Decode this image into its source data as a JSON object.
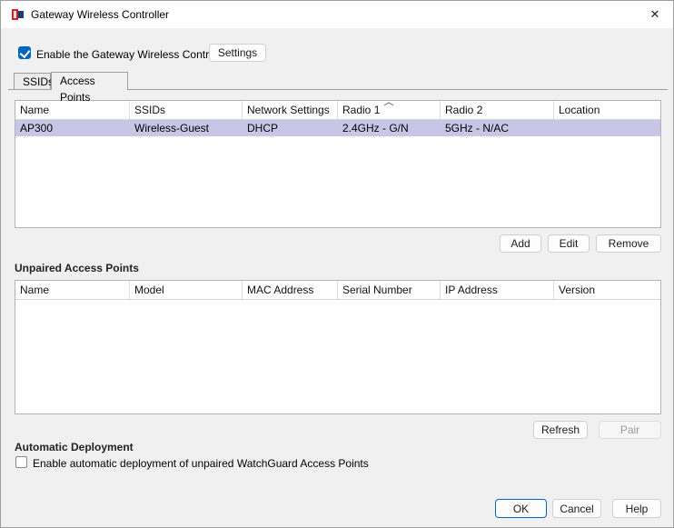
{
  "window": {
    "title": "Gateway Wireless Controller",
    "close_glyph": "✕"
  },
  "enable_controller": {
    "label": "Enable the Gateway Wireless Controller",
    "checked": true,
    "settings_button": "Settings"
  },
  "tabs": [
    {
      "label": "SSIDs",
      "selected": false
    },
    {
      "label": "Access Points",
      "selected": true
    }
  ],
  "access_points_table": {
    "columns": [
      "Name",
      "SSIDs",
      "Network Settings",
      "Radio 1",
      "Radio 2",
      "Location"
    ],
    "sorted_column": "Radio 1",
    "sort_direction": "asc",
    "rows": [
      {
        "selected": true,
        "cells": [
          "AP300",
          "Wireless-Guest",
          "DHCP",
          "2.4GHz - G/N",
          "5GHz - N/AC",
          ""
        ]
      }
    ]
  },
  "access_points_buttons": {
    "add": "Add",
    "edit": "Edit",
    "remove": "Remove"
  },
  "unpaired": {
    "heading": "Unpaired Access Points",
    "columns": [
      "Name",
      "Model",
      "MAC Address",
      "Serial Number",
      "IP Address",
      "Version"
    ],
    "rows": []
  },
  "unpaired_buttons": {
    "refresh": "Refresh",
    "pair": "Pair",
    "pair_enabled": false
  },
  "automatic_deployment": {
    "heading": "Automatic Deployment",
    "label": "Enable automatic deployment of unpaired WatchGuard Access Points",
    "checked": false
  },
  "footer": {
    "ok": "OK",
    "cancel": "Cancel",
    "help": "Help"
  },
  "colors": {
    "selection": "#c9c5e7",
    "accent": "#0067c0",
    "titlebar": "#ffffff"
  }
}
